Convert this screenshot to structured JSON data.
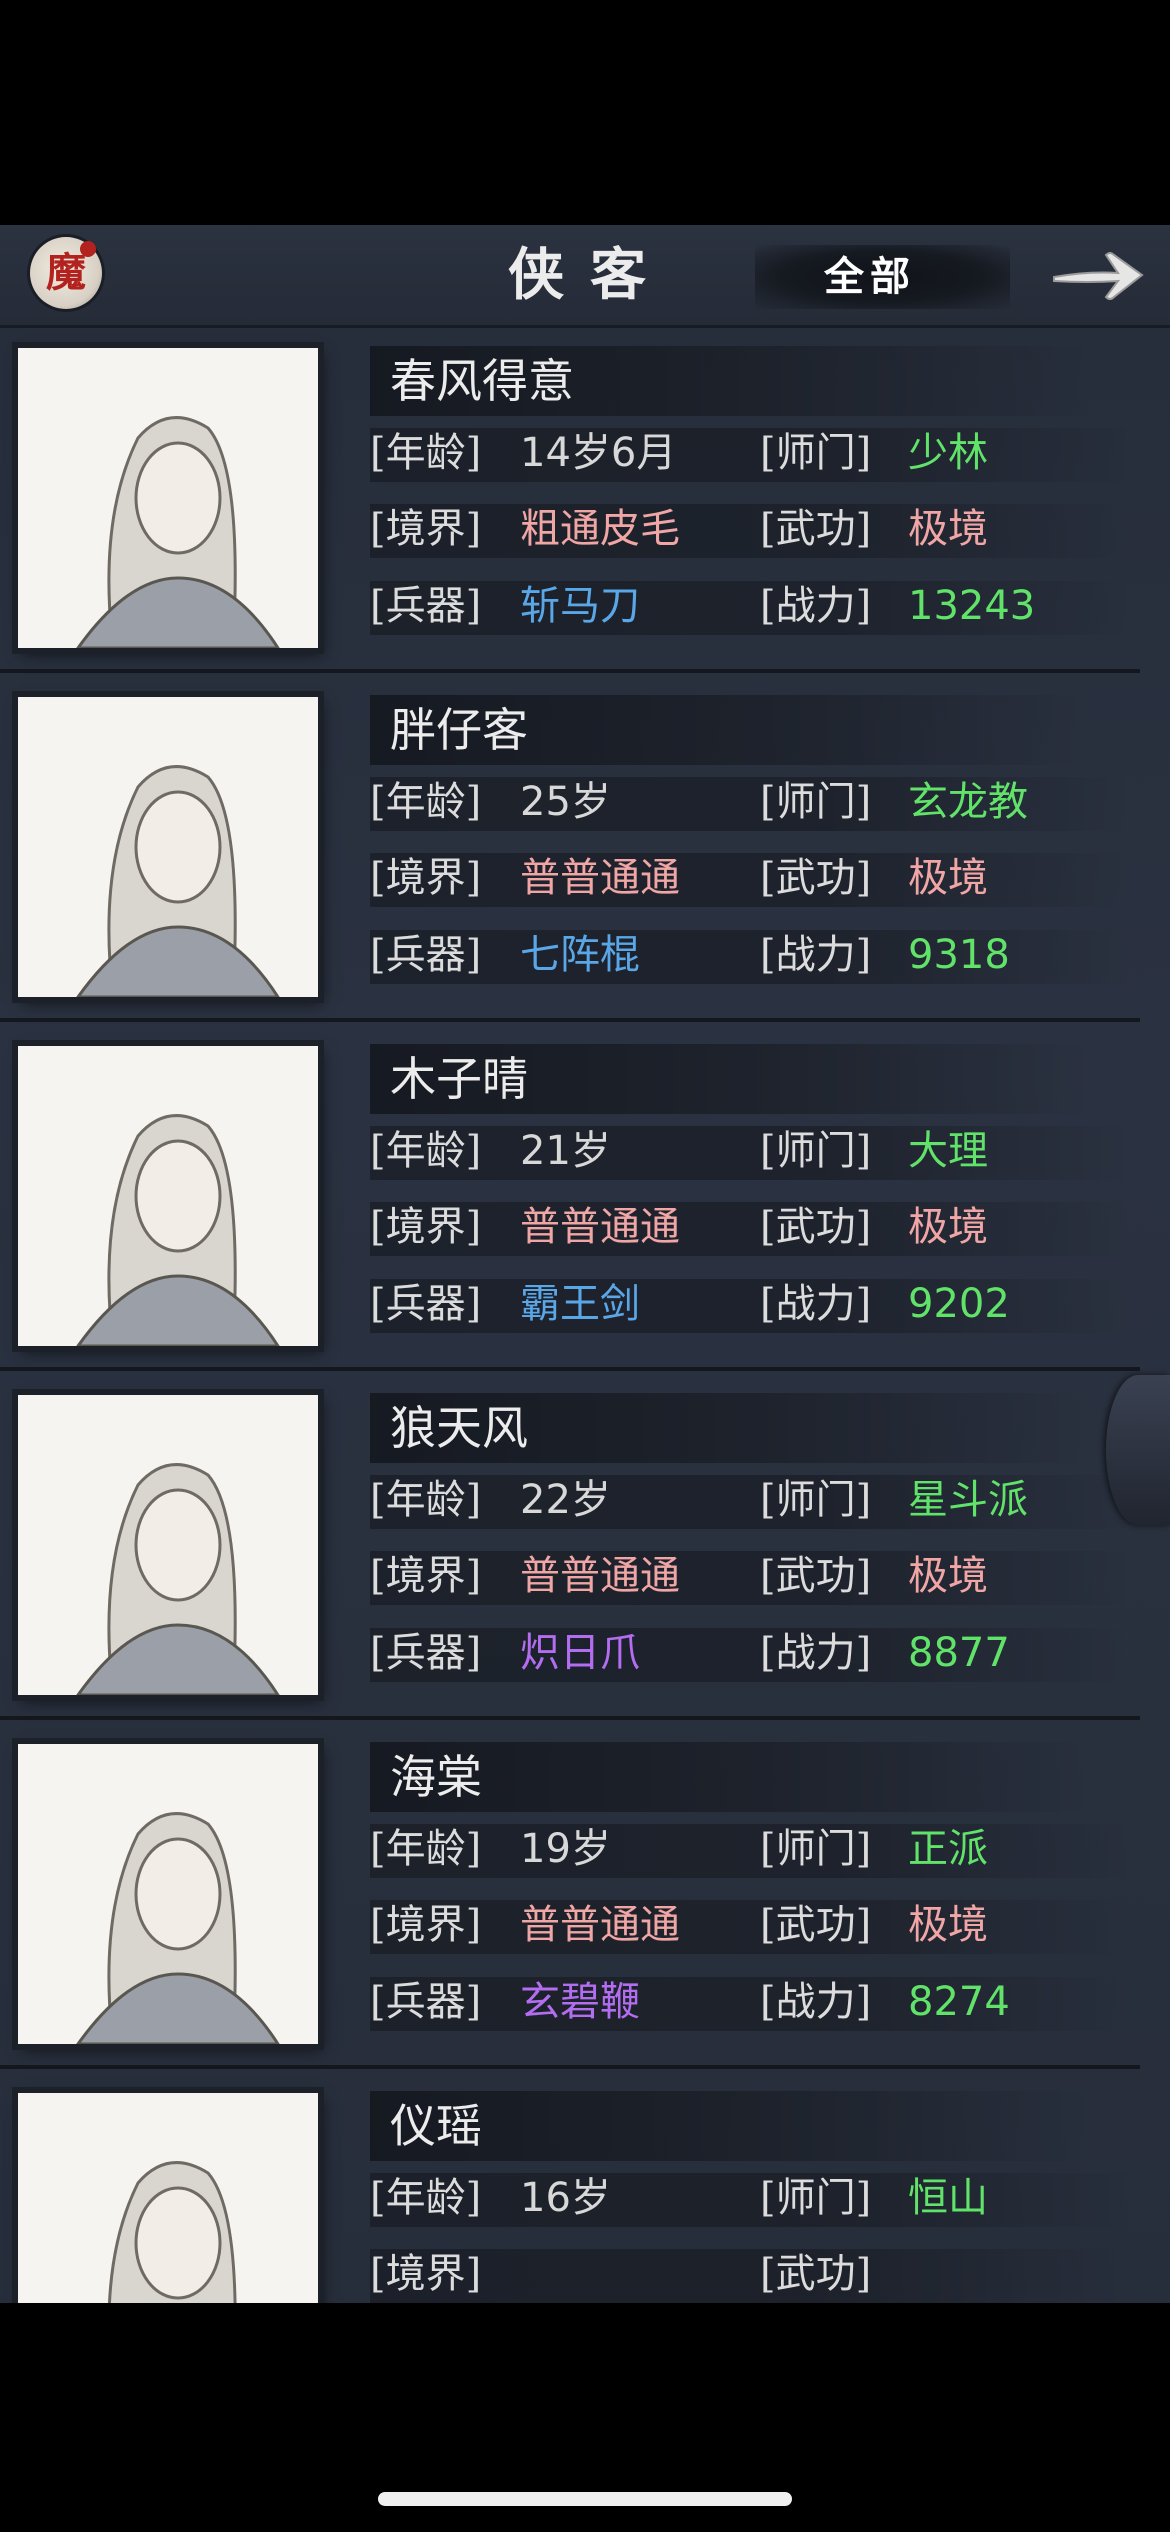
{
  "header": {
    "logo_text": "魔",
    "title": "侠客",
    "filter_label": "全部",
    "next_icon": "arrow-right-icon"
  },
  "labels": {
    "age": "[年龄]",
    "sect": "[师门]",
    "realm": "[境界]",
    "skill": "[武功]",
    "weapon": "[兵器]",
    "power": "[战力]"
  },
  "heroes": [
    {
      "name": "春风得意",
      "age": "14岁6月",
      "sect": "少林",
      "realm": "粗通皮毛",
      "skill": "极境",
      "weapon": "斩马刀",
      "weapon_color": "#5aa7e8",
      "power": "13243"
    },
    {
      "name": "胖仔客",
      "age": "25岁",
      "sect": "玄龙教",
      "realm": "普普通通",
      "skill": "极境",
      "weapon": "七阵棍",
      "weapon_color": "#5aa7e8",
      "power": "9318"
    },
    {
      "name": "木子晴",
      "age": "21岁",
      "sect": "大理",
      "realm": "普普通通",
      "skill": "极境",
      "weapon": "霸王剑",
      "weapon_color": "#5aa7e8",
      "power": "9202"
    },
    {
      "name": "狼天风",
      "age": "22岁",
      "sect": "星斗派",
      "realm": "普普通通",
      "skill": "极境",
      "weapon": "炽日爪",
      "weapon_color": "#b36df0",
      "power": "8877"
    },
    {
      "name": "海棠",
      "age": "19岁",
      "sect": "正派",
      "realm": "普普通通",
      "skill": "极境",
      "weapon": "玄碧鞭",
      "weapon_color": "#b36df0",
      "power": "8274"
    },
    {
      "name": "仪瑶",
      "age": "16岁",
      "sect": "恒山",
      "realm": "",
      "skill": "",
      "weapon": "",
      "weapon_color": "#5aa7e8",
      "power": ""
    }
  ]
}
